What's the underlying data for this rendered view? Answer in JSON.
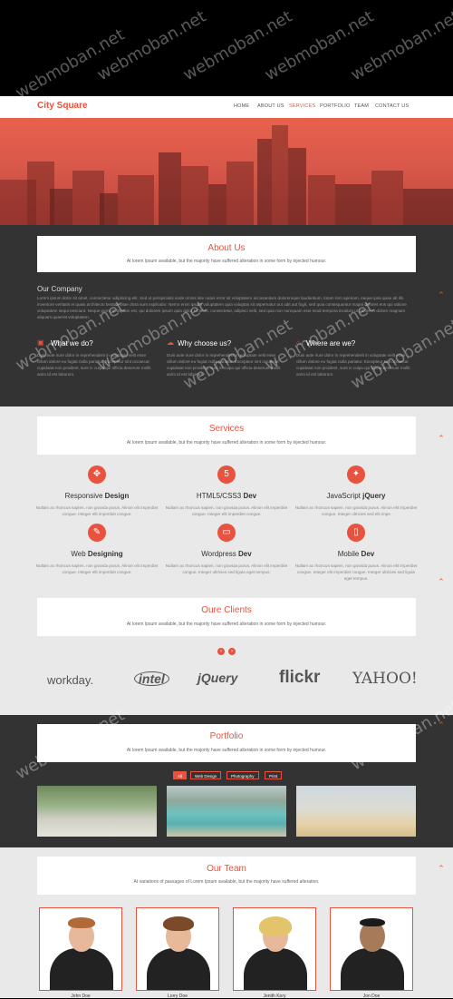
{
  "header": {
    "logo": "City Square",
    "nav": [
      "HOME",
      "ABOUT US",
      "SERVICES",
      "PORTFOLIO",
      "TEAM",
      "CONTACT US"
    ],
    "active_nav": "SERVICES",
    "accent": "#e8533f"
  },
  "watermark": "webmoban.net",
  "about": {
    "title": "About Us",
    "subtitle": "At lorem Ipsum available, but the majority have suffered alteration in some form by injected humour.",
    "company_heading": "Our Company",
    "company_text": "Lorem ipsum dolor sit amet, consectetur adipiscing elit. Sed ut perspiciatis unde omnis iste natus error sit voluptatem accusantium doloremque laudantium, totam rem aperiam, eaque ipsa quae ab illo inventore veritatis et quasi architecto beatae vitae dicta sunt explicabo. Nemo enim ipsam voluptatem quia voluptas sit aspernatur aut odit aut fugit, sed quia consequuntur magni dolores eos qui ratione voluptatem sequi nesciunt. Neque porro quisquam est, qui dolorem ipsum quia dolor sit amet, consectetur, adipisci velit, sed quia non numquam eius modi tempora incidunt ut labore et dolore magnam aliquam quaerat voluptatem.",
    "columns": [
      {
        "icon": "monitor-icon",
        "title": "What we do?",
        "text": "Duis aute irure dolor in reprehenderit in voluptate velit esse cillum dolore eu fugiat nulla pariatur. Excepteur sint occaecat cupidatat non proident, sunt in culpa qui officia deserunt mollit anim id est laborum."
      },
      {
        "icon": "cloud-icon",
        "title": "Why choose us?",
        "text": "Duis aute irure dolor in reprehenderit in voluptate velit esse cillum dolore eu fugiat nulla pariatur. Excepteur sint occaecat cupidatat non proident, sunt in culpa qui officia deserunt mollit anim id est laborum."
      },
      {
        "icon": "home-icon",
        "title": "Where are we?",
        "text": "Duis aute irure dolor in reprehenderit in voluptate velit esse cillum dolore eu fugiat nulla pariatur. Excepteur sint occaecat cupidatat non proident, sunt in culpa qui officia deserunt mollit anim id est laborum."
      }
    ]
  },
  "services": {
    "title": "Services",
    "subtitle": "At lorem Ipsum available, but the majority have suffered alteration in some form by injected humour.",
    "items": [
      {
        "icon": "move-icon",
        "glyph": "✥",
        "title_pre": "Responsive ",
        "title_bold": "Design",
        "text": "Nullam ac rhoncus sapien, non gravida purus. Alinon elit imperdiet congue. Integer elit imperdiet congue."
      },
      {
        "icon": "html5-icon",
        "glyph": "5",
        "title_pre": "HTML5/CSS3 ",
        "title_bold": "Dev",
        "text": "Nullam ac rhoncus sapien, non gravida purus. Alinon elit imperdiet congue. Integer elit imperdiet congue."
      },
      {
        "icon": "rocket-icon",
        "glyph": "✦",
        "title_pre": "JavaScript ",
        "title_bold": "jQuery",
        "text": "Nullam ac rhoncus sapien, non gravida purus. Alinon elit imperdiet congue. Integer ultricies sed elit impe"
      },
      {
        "icon": "brush-icon",
        "glyph": "✎",
        "title_pre": "Web ",
        "title_bold": "Designing",
        "text": "Nullam ac rhoncus sapien, non gravida purus. Alinon elit imperdiet congue. Integer elit imperdiet congue."
      },
      {
        "icon": "desktop-icon",
        "glyph": "▭",
        "title_pre": "Wordpress ",
        "title_bold": "Dev",
        "text": "Nullam ac rhoncus sapien, non gravida purus. Alinon elit imperdiet congue. Integer ultricies sed ligula eget tempus."
      },
      {
        "icon": "mobile-icon",
        "glyph": "▯",
        "title_pre": "Mobile ",
        "title_bold": "Dev",
        "text": "Nullam ac rhoncus sapien, non gravida purus. Alinon elit imperdiet congue. Integer elit imperdiet congue. Integer ultricies sed ligula eget tempus."
      }
    ]
  },
  "clients": {
    "title": "Oure Clients",
    "subtitle": "At lorem Ipsum available, but the majority have suffered alteration in some form by injected humour.",
    "logos": [
      "workday.",
      "intel",
      "jQuery",
      "flickr",
      "YAHOO!"
    ]
  },
  "portfolio": {
    "title": "Portfolio",
    "subtitle": "At lorem Ipsum available, but the majority have suffered alteration in some form by injected humour.",
    "filters": [
      "All",
      "Web Design",
      "Photography",
      "Print"
    ]
  },
  "team": {
    "title": "Our Team",
    "subtitle": "At variations of passages of Lorem Ipsum available, but the majority have suffered alteration.",
    "members": [
      "John Doe",
      "Lorry Doe",
      "Jenith Kory",
      "Jon Doe"
    ]
  }
}
